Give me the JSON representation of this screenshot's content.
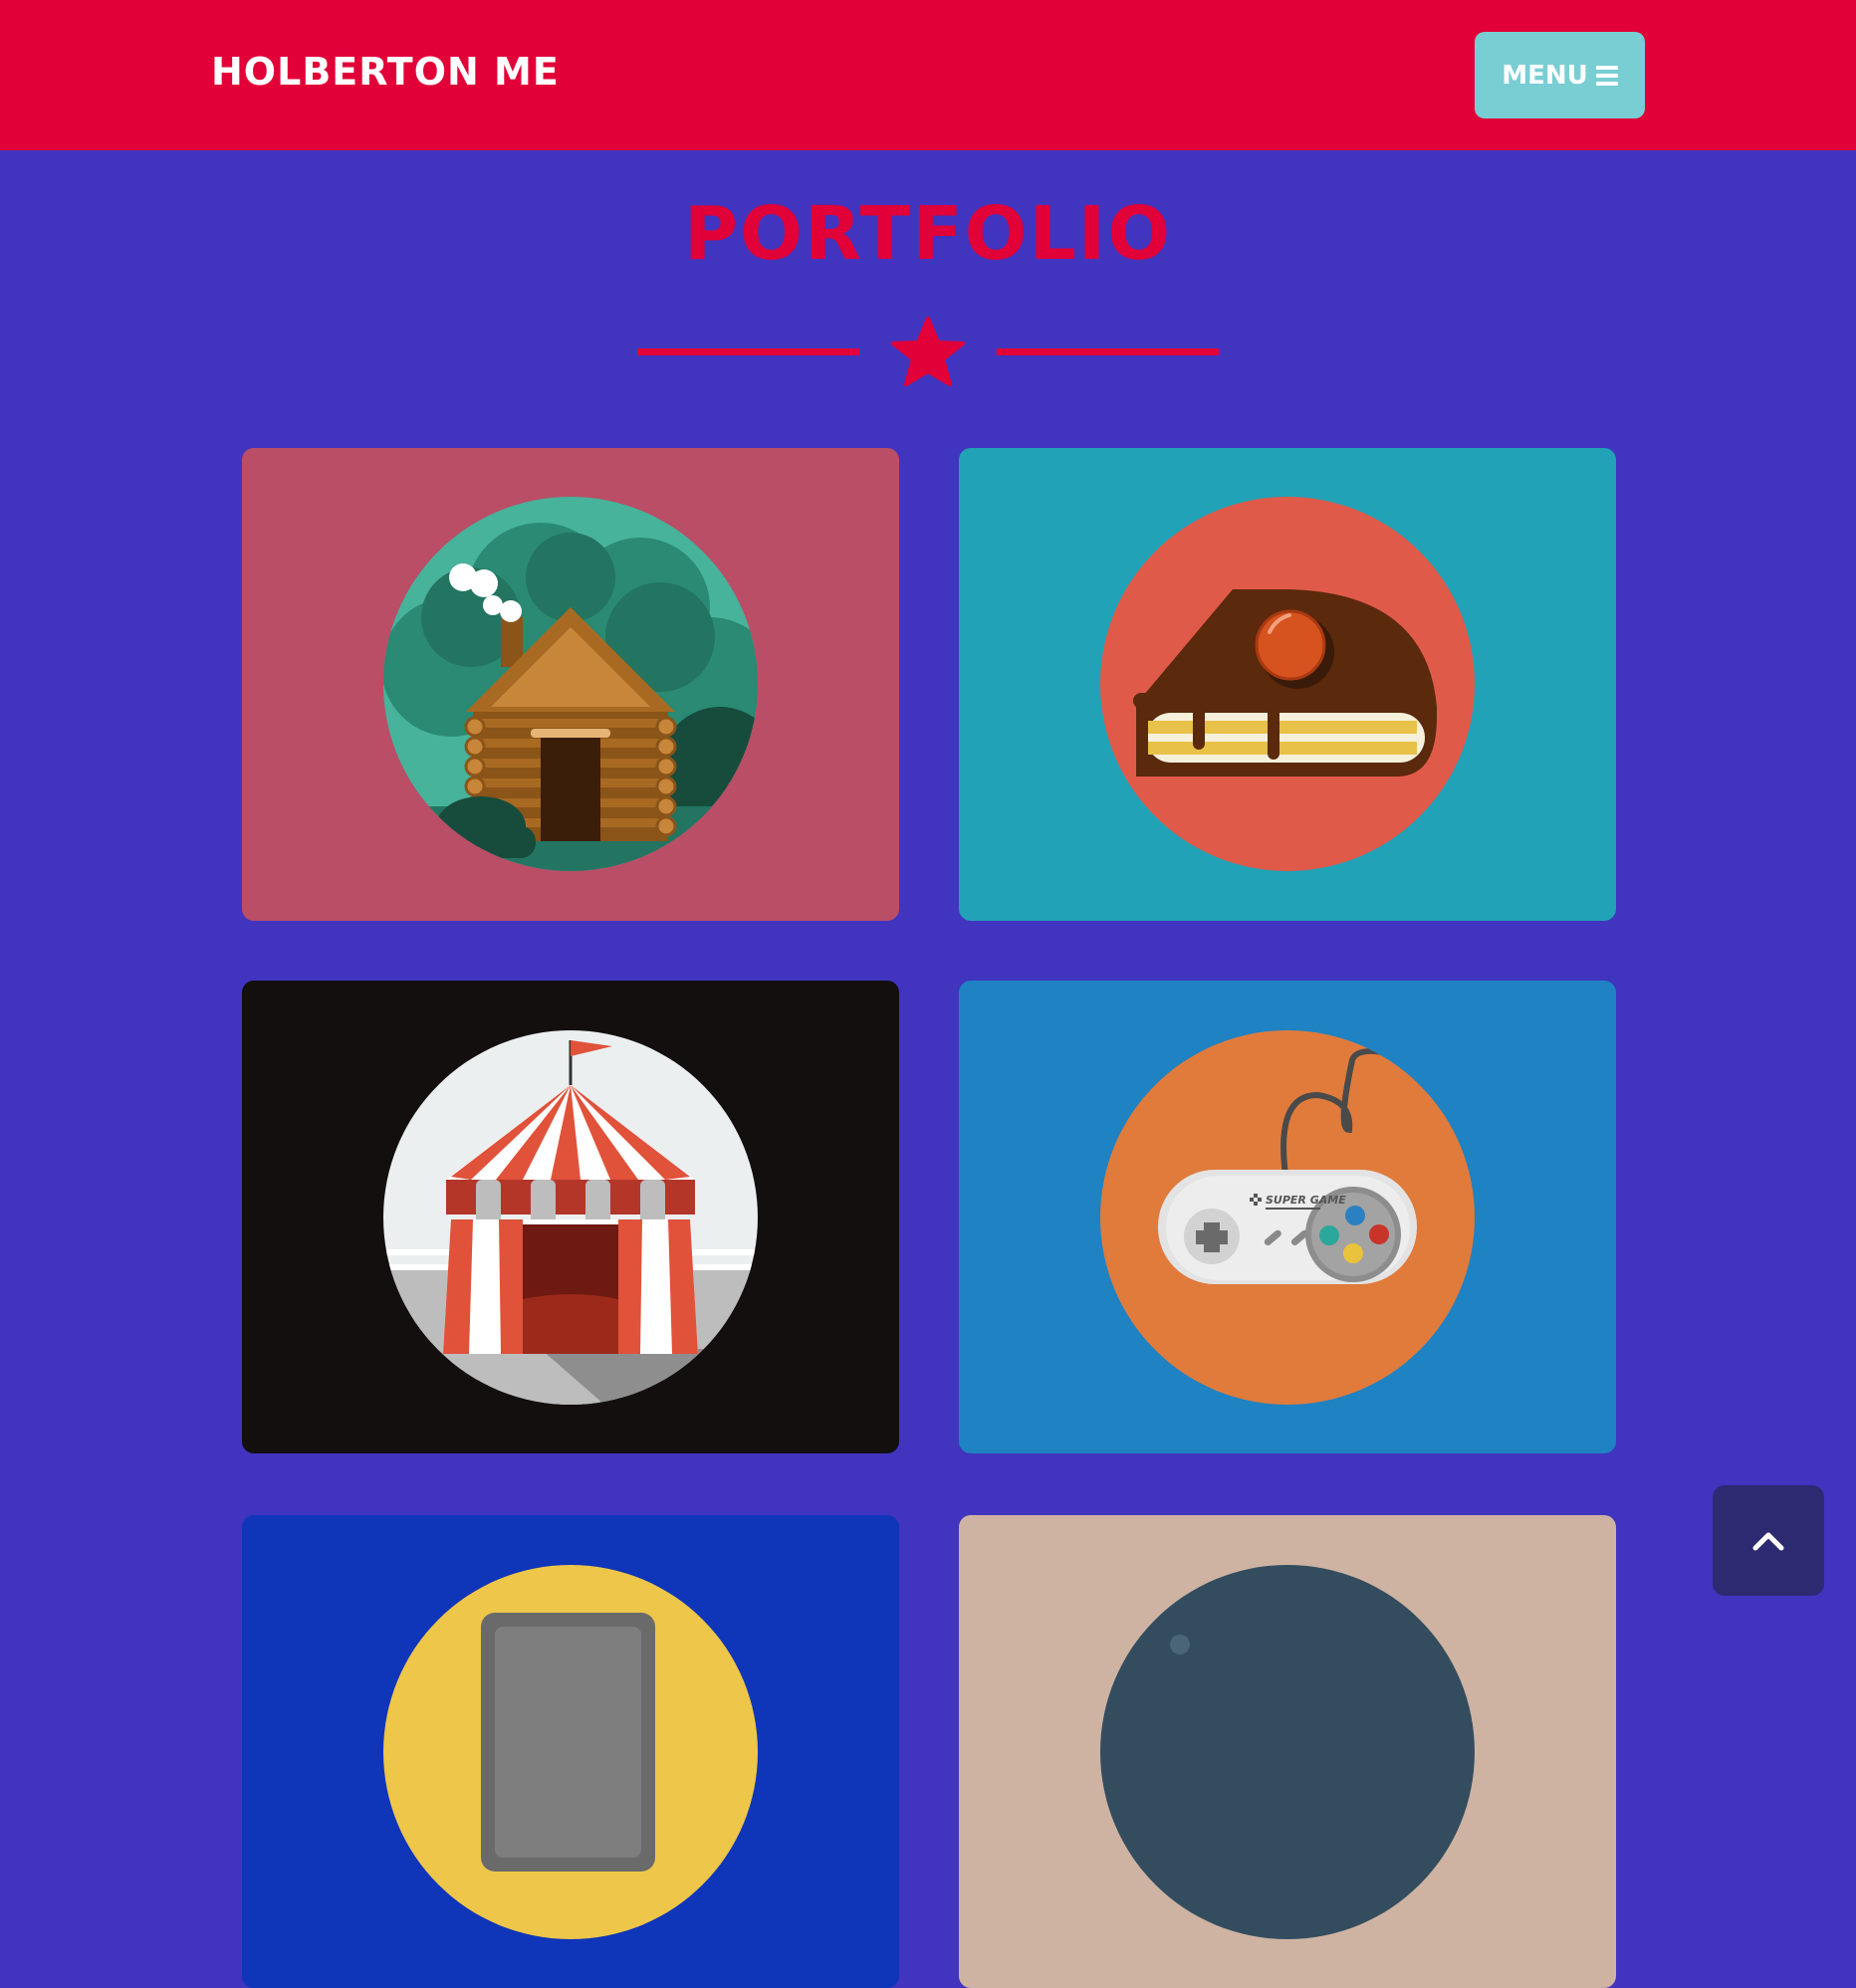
{
  "navbar": {
    "brand": "HOLBERTON ME",
    "menu_label": "MENU"
  },
  "portfolio": {
    "title": "PORTFOLIO",
    "items": [
      {
        "icon": "cabin-icon",
        "bg": "#B94E66"
      },
      {
        "icon": "cake-icon",
        "bg": "#21A2B7"
      },
      {
        "icon": "circus-tent-icon",
        "bg": "#130F0F"
      },
      {
        "icon": "game-controller-icon",
        "bg": "#1F82C2",
        "controller_text": "SUPER GAME"
      },
      {
        "icon": "safe-icon",
        "bg": "#0F35B8"
      },
      {
        "icon": "submarine-icon",
        "bg": "#CEB3A3"
      }
    ]
  },
  "colors": {
    "accent": "#E10037",
    "background": "#4134BF",
    "menu_button": "#79CED3",
    "scroll_top_button": "#2E2A72"
  }
}
